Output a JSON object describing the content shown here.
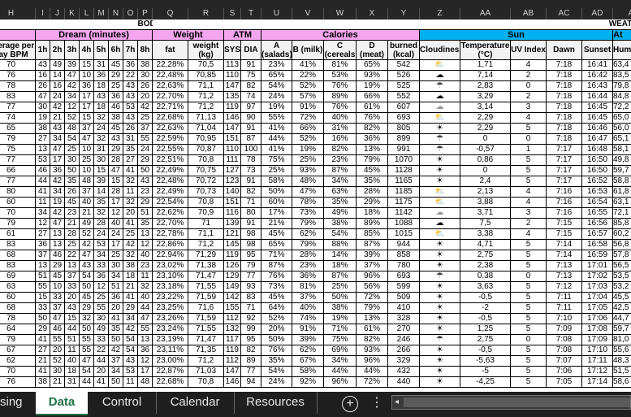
{
  "column_letters": [
    "H",
    "I",
    "J",
    "K",
    "L",
    "M",
    "N",
    "O",
    "P",
    "Q",
    "R",
    "S",
    "T",
    "U",
    "V",
    "W",
    "X",
    "Y",
    "Z",
    "AA",
    "AB",
    "AC",
    "AD",
    "A"
  ],
  "sections": {
    "body": "BODY",
    "weather": "WEATHER"
  },
  "groups": {
    "dream": "Dream (minutes)",
    "weight": "Weight",
    "atm": "ATM",
    "calories": "Calories",
    "sun": "Sun",
    "atmosphere": "At"
  },
  "headers": [
    "Average per day BPM",
    "1h",
    "2h",
    "3h",
    "4h",
    "5h",
    "6h",
    "7h",
    "8h",
    "fat",
    "weight (kg)",
    "SYS",
    "DIA",
    "A (salads)",
    "B (milk)",
    "C (cereals",
    "D (meat)",
    "burned (kcal)",
    "Cloudiness",
    "Temperature (°C)",
    "UV Index",
    "Dawn",
    "Sunset",
    "Humi"
  ],
  "colors": {
    "pink_header": "#f3a6ee",
    "blue_header": "#00b0f0",
    "active_tab": "#217346"
  },
  "icons": {
    "sun": "☀",
    "cloud": "☁",
    "partly-cloudy": "⛅",
    "rain": "☂",
    "cloud-outline": "☁"
  },
  "rows": [
    [
      "70",
      "43",
      "49",
      "39",
      "15",
      "31",
      "45",
      "36",
      "38",
      "22,28%",
      "70,5",
      "113",
      "91",
      "23%",
      "41%",
      "81%",
      "65%",
      "542",
      "partly-cloudy",
      "1,71",
      "4",
      "7:18",
      "16:41",
      "63,4"
    ],
    [
      "76",
      "16",
      "14",
      "47",
      "10",
      "36",
      "29",
      "22",
      "30",
      "22,48%",
      "70,85",
      "110",
      "75",
      "65%",
      "22%",
      "53%",
      "93%",
      "526",
      "cloud",
      "7,14",
      "2",
      "7:18",
      "16:42",
      "83,5"
    ],
    [
      "78",
      "26",
      "16",
      "42",
      "36",
      "18",
      "25",
      "43",
      "26",
      "22,63%",
      "71,1",
      "147",
      "82",
      "54%",
      "52%",
      "76%",
      "19%",
      "525",
      "rain",
      "2,83",
      "0",
      "7:18",
      "16:43",
      "79,8"
    ],
    [
      "83",
      "47",
      "24",
      "34",
      "17",
      "43",
      "36",
      "43",
      "20",
      "22,70%",
      "71,2",
      "135",
      "74",
      "24%",
      "57%",
      "89%",
      "66%",
      "552",
      "cloud",
      "3,29",
      "2",
      "7:18",
      "16:44",
      "84,8"
    ],
    [
      "77",
      "30",
      "42",
      "12",
      "17",
      "18",
      "46",
      "53",
      "42",
      "22,71%",
      "71,2",
      "119",
      "97",
      "19%",
      "91%",
      "76%",
      "61%",
      "607",
      "cloud-outline",
      "3,14",
      "3",
      "7:18",
      "16:45",
      "72,2"
    ],
    [
      "74",
      "19",
      "21",
      "52",
      "15",
      "32",
      "38",
      "43",
      "25",
      "22,68%",
      "71,13",
      "146",
      "90",
      "55%",
      "72%",
      "40%",
      "76%",
      "693",
      "partly-cloudy",
      "2,29",
      "4",
      "7:18",
      "16:45",
      "65,0"
    ],
    [
      "65",
      "38",
      "43",
      "48",
      "37",
      "24",
      "45",
      "26",
      "37",
      "22,63%",
      "71,04",
      "147",
      "91",
      "41%",
      "66%",
      "31%",
      "82%",
      "805",
      "sun",
      "2,29",
      "5",
      "7:18",
      "16:46",
      "56,0"
    ],
    [
      "79",
      "27",
      "34",
      "54",
      "47",
      "32",
      "43",
      "31",
      "55",
      "22,59%",
      "70,95",
      "151",
      "87",
      "44%",
      "52%",
      "16%",
      "36%",
      "899",
      "rain",
      "0",
      "0",
      "7:18",
      "16:47",
      "65,1"
    ],
    [
      "75",
      "13",
      "47",
      "25",
      "10",
      "31",
      "29",
      "35",
      "24",
      "22,55%",
      "70,87",
      "110",
      "100",
      "41%",
      "19%",
      "82%",
      "13%",
      "991",
      "rain",
      "-0,57",
      "1",
      "7:17",
      "16:48",
      "58,1"
    ],
    [
      "77",
      "53",
      "17",
      "30",
      "25",
      "30",
      "28",
      "27",
      "29",
      "22,51%",
      "70,8",
      "111",
      "78",
      "75%",
      "25%",
      "23%",
      "79%",
      "1070",
      "sun",
      "0,86",
      "5",
      "7:17",
      "16:50",
      "49,8"
    ],
    [
      "66",
      "46",
      "36",
      "50",
      "10",
      "15",
      "47",
      "41",
      "50",
      "22,49%",
      "70,75",
      "127",
      "73",
      "25%",
      "93%",
      "87%",
      "45%",
      "1128",
      "sun",
      "0",
      "5",
      "7:17",
      "16:50",
      "59,7"
    ],
    [
      "77",
      "44",
      "42",
      "35",
      "48",
      "39",
      "15",
      "32",
      "43",
      "22,48%",
      "70,72",
      "123",
      "91",
      "58%",
      "48%",
      "34%",
      "35%",
      "1165",
      "sun",
      "2,4",
      "5",
      "7:17",
      "16:52",
      "58,8"
    ],
    [
      "80",
      "41",
      "34",
      "26",
      "37",
      "14",
      "28",
      "11",
      "23",
      "22,49%",
      "70,73",
      "140",
      "82",
      "50%",
      "47%",
      "63%",
      "28%",
      "1185",
      "partly-cloudy",
      "2,13",
      "4",
      "7:16",
      "16:53",
      "61,8"
    ],
    [
      "60",
      "11",
      "19",
      "45",
      "40",
      "35",
      "17",
      "32",
      "29",
      "22,54%",
      "70,8",
      "151",
      "71",
      "60%",
      "78%",
      "35%",
      "29%",
      "1175",
      "partly-cloudy",
      "3,88",
      "4",
      "7:16",
      "16:54",
      "63,1"
    ],
    [
      "70",
      "34",
      "42",
      "23",
      "21",
      "32",
      "12",
      "20",
      "51",
      "22,62%",
      "70,9",
      "116",
      "80",
      "17%",
      "73%",
      "49%",
      "18%",
      "1142",
      "cloud-outline",
      "3,71",
      "3",
      "7:16",
      "16:55",
      "72,1"
    ],
    [
      "79",
      "12",
      "47",
      "21",
      "49",
      "28",
      "40",
      "41",
      "35",
      "22,70%",
      "71",
      "139",
      "91",
      "21%",
      "79%",
      "38%",
      "89%",
      "1088",
      "cloud",
      "7,5",
      "2",
      "7:15",
      "16:56",
      "85,8"
    ],
    [
      "61",
      "27",
      "13",
      "28",
      "52",
      "24",
      "24",
      "25",
      "13",
      "22,78%",
      "71,1",
      "121",
      "98",
      "45%",
      "62%",
      "54%",
      "85%",
      "1015",
      "partly-cloudy",
      "3,38",
      "4",
      "7:15",
      "16:57",
      "60,2"
    ],
    [
      "83",
      "36",
      "13",
      "25",
      "42",
      "53",
      "17",
      "42",
      "12",
      "22,86%",
      "71,2",
      "145",
      "98",
      "65%",
      "79%",
      "88%",
      "87%",
      "944",
      "sun",
      "4,71",
      "5",
      "7:14",
      "16:58",
      "56,8"
    ],
    [
      "68",
      "37",
      "46",
      "22",
      "47",
      "34",
      "25",
      "32",
      "40",
      "22,94%",
      "71,29",
      "119",
      "95",
      "71%",
      "28%",
      "14%",
      "39%",
      "858",
      "sun",
      "2,75",
      "5",
      "7:14",
      "16:59",
      "57,8"
    ],
    [
      "83",
      "13",
      "29",
      "13",
      "43",
      "33",
      "30",
      "38",
      "23",
      "23,02%",
      "71,38",
      "126",
      "79",
      "87%",
      "23%",
      "18%",
      "37%",
      "780",
      "sun",
      "2,38",
      "5",
      "7:13",
      "17:01",
      "56,5"
    ],
    [
      "69",
      "51",
      "45",
      "37",
      "54",
      "36",
      "34",
      "18",
      "11",
      "23,10%",
      "71,47",
      "129",
      "77",
      "76%",
      "36%",
      "87%",
      "96%",
      "693",
      "rain",
      "0,38",
      "0",
      "7:13",
      "17:02",
      "53,5"
    ],
    [
      "63",
      "55",
      "10",
      "33",
      "50",
      "12",
      "51",
      "21",
      "32",
      "23,18%",
      "71,55",
      "149",
      "93",
      "73%",
      "81%",
      "25%",
      "56%",
      "599",
      "sun",
      "3,63",
      "5",
      "7:12",
      "17:03",
      "53,2"
    ],
    [
      "60",
      "15",
      "33",
      "20",
      "45",
      "25",
      "36",
      "41",
      "40",
      "23,22%",
      "71,59",
      "142",
      "83",
      "45%",
      "37%",
      "50%",
      "72%",
      "509",
      "sun",
      "-0,5",
      "5",
      "7:11",
      "17:04",
      "45,5"
    ],
    [
      "68",
      "33",
      "37",
      "43",
      "29",
      "55",
      "20",
      "29",
      "44",
      "23,25%",
      "71,6",
      "155",
      "71",
      "64%",
      "40%",
      "38%",
      "79%",
      "410",
      "sun",
      "-2",
      "5",
      "7:11",
      "17:05",
      "42,5"
    ],
    [
      "78",
      "50",
      "47",
      "15",
      "32",
      "30",
      "41",
      "34",
      "47",
      "23,26%",
      "71,59",
      "112",
      "92",
      "52%",
      "74%",
      "19%",
      "13%",
      "328",
      "sun",
      "-0,5",
      "5",
      "7:10",
      "17:06",
      "44,7"
    ],
    [
      "64",
      "29",
      "46",
      "44",
      "50",
      "49",
      "35",
      "42",
      "55",
      "23,24%",
      "71,55",
      "132",
      "99",
      "20%",
      "91%",
      "71%",
      "61%",
      "270",
      "sun",
      "1,25",
      "5",
      "7:09",
      "17:08",
      "59,7"
    ],
    [
      "79",
      "41",
      "55",
      "51",
      "55",
      "33",
      "50",
      "54",
      "13",
      "23,19%",
      "71,47",
      "117",
      "95",
      "50%",
      "39%",
      "75%",
      "82%",
      "246",
      "rain",
      "2,75",
      "0",
      "7:08",
      "17:09",
      "81,0"
    ],
    [
      "67",
      "27",
      "20",
      "11",
      "55",
      "22",
      "42",
      "54",
      "36",
      "23,11%",
      "71,35",
      "119",
      "82",
      "76%",
      "62%",
      "69%",
      "93%",
      "266",
      "sun",
      "-0,5",
      "5",
      "7:08",
      "17:10",
      "55,6"
    ],
    [
      "62",
      "21",
      "52",
      "40",
      "47",
      "44",
      "37",
      "43",
      "12",
      "23,00%",
      "71,2",
      "112",
      "89",
      "35%",
      "67%",
      "34%",
      "96%",
      "329",
      "sun",
      "-5,63",
      "5",
      "7:07",
      "17:11",
      "48,3"
    ],
    [
      "70",
      "41",
      "30",
      "18",
      "54",
      "20",
      "34",
      "53",
      "17",
      "22,87%",
      "71,03",
      "147",
      "77",
      "54%",
      "58%",
      "44%",
      "44%",
      "432",
      "sun",
      "-5",
      "5",
      "7:06",
      "17:12",
      "51,5"
    ],
    [
      "76",
      "38",
      "21",
      "31",
      "44",
      "41",
      "50",
      "11",
      "48",
      "22,68%",
      "70,8",
      "146",
      "94",
      "24%",
      "92%",
      "96%",
      "72%",
      "440",
      "sun",
      "-4,25",
      "5",
      "7:05",
      "17:14",
      "58,6"
    ]
  ],
  "sheet_tabs": [
    {
      "label": "sing",
      "active": false
    },
    {
      "label": "Data",
      "active": true
    },
    {
      "label": "Control",
      "active": false
    },
    {
      "label": "Calendar",
      "active": false
    },
    {
      "label": "Resources",
      "active": false
    }
  ],
  "tab_controls": {
    "add_sheet": "+",
    "more": "⋮",
    "scroll_left": "◂"
  }
}
